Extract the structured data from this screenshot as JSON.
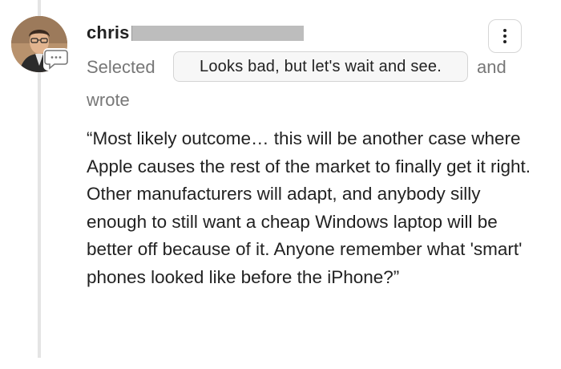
{
  "comment": {
    "username": "chris",
    "selected_label": "Selected",
    "selection_text": "Looks bad, but let's wait and see.",
    "and_label": "and",
    "wrote_label": "wrote",
    "quote_text": "“Most likely outcome… this will be another case where Apple causes the rest of the market to finally get it right. Other manufacturers will adapt, and anybody silly enough to still want a cheap Windows laptop will be better off because of it. Anyone remember what 'smart' phones looked like before the iPhone?”"
  },
  "icons": {
    "avatar": "user-avatar",
    "badge": "comment-bubble-icon",
    "menu": "more-vertical-icon"
  },
  "colors": {
    "timeline": "#e4e4e4",
    "muted_text": "#777777",
    "pill_background": "#f7f7f7",
    "redaction": "#bdbdbd"
  }
}
